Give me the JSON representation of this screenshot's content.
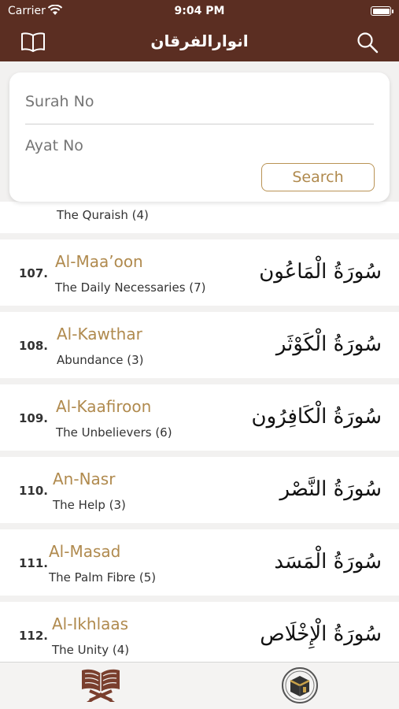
{
  "status_bar": {
    "carrier": "Carrier",
    "time": "9:04 PM"
  },
  "navbar": {
    "title": "انوارالفرقان",
    "left_icon": "book-icon",
    "right_icon": "search-icon"
  },
  "search_form": {
    "surah_placeholder": "Surah No",
    "ayat_placeholder": "Ayat No",
    "submit_label": "Search"
  },
  "partial_item": {
    "meaning": "The Quraish (4)"
  },
  "surahs": [
    {
      "number": "107.",
      "name": "Al-Maa’oon",
      "meaning": "The Daily Necessaries (7)",
      "arabic": "سُورَةُ الْمَاعُون"
    },
    {
      "number": "108.",
      "name": "Al-Kawthar",
      "meaning": "Abundance (3)",
      "arabic": "سُورَةُ الْكَوْثَر"
    },
    {
      "number": "109.",
      "name": "Al-Kaafiroon",
      "meaning": "The Unbelievers (6)",
      "arabic": "سُورَةُ الْكَافِرُون"
    },
    {
      "number": "110.",
      "name": "An-Nasr",
      "meaning": "The Help (3)",
      "arabic": "سُورَةُ النَّصْر"
    },
    {
      "number": "111.",
      "name": "Al-Masad",
      "meaning": "The Palm Fibre (5)",
      "arabic": "سُورَةُ الْمَسَد"
    },
    {
      "number": "112.",
      "name": "Al-Ikhlaas",
      "meaning": "The Unity (4)",
      "arabic": "سُورَةُ الْإِخْلَاص"
    }
  ],
  "tab_bar": {
    "tabs": [
      {
        "icon": "quran-book-icon"
      },
      {
        "icon": "kaaba-icon"
      }
    ]
  },
  "colors": {
    "header": "#5b2e22",
    "accent": "#b08a4e"
  }
}
